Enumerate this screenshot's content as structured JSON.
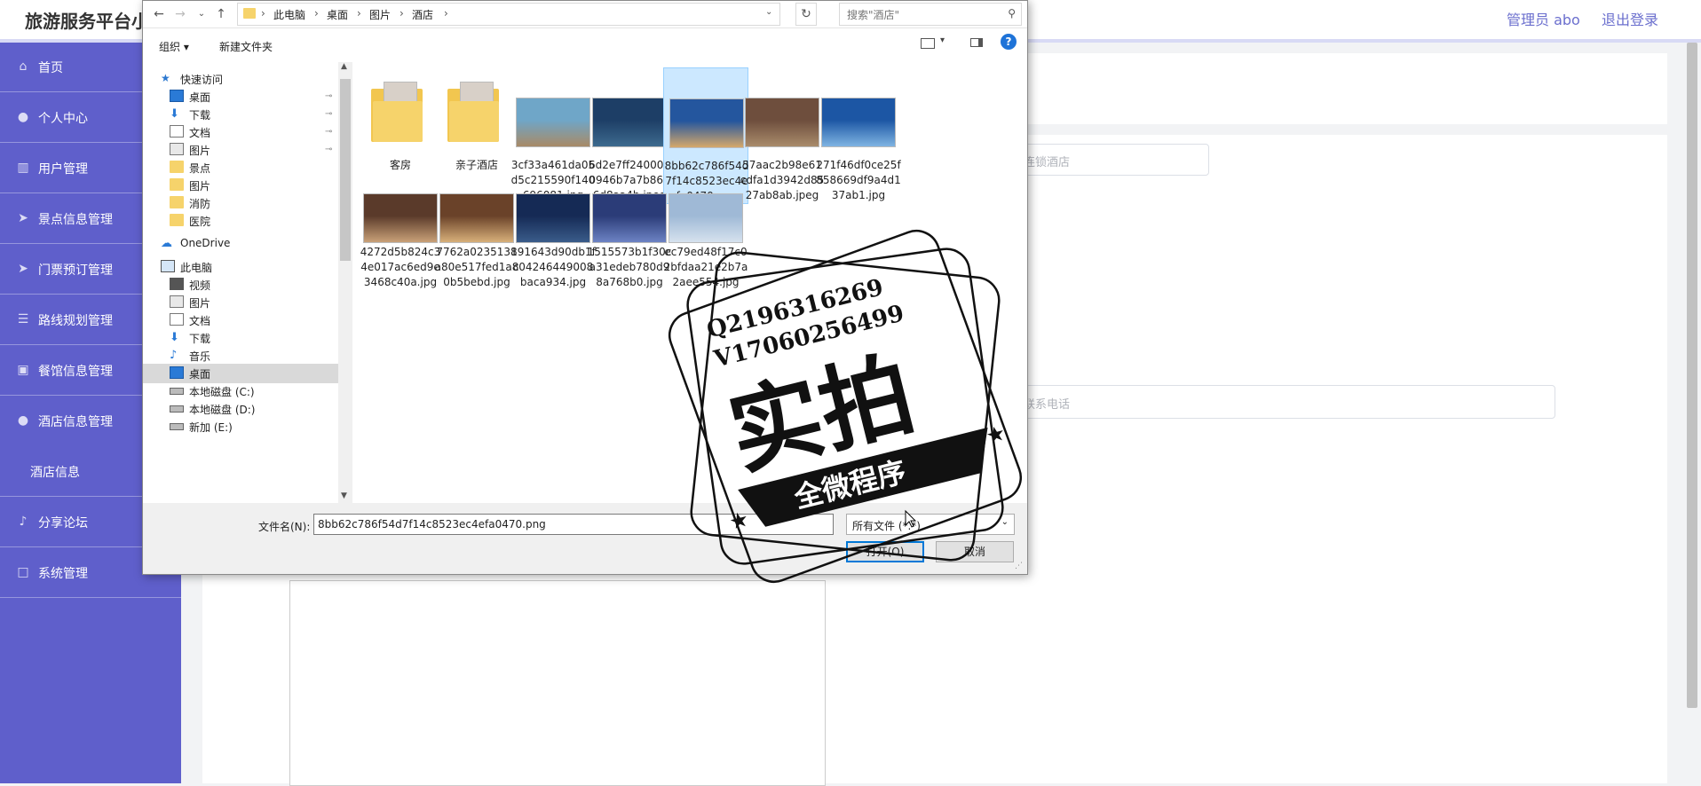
{
  "app": {
    "title": "旅游服务平台小",
    "admin": "管理员 abo",
    "logout": "退出登录"
  },
  "sidebar": {
    "items": [
      {
        "label": "首页",
        "icon": "home-icon"
      },
      {
        "label": "个人中心",
        "icon": "user-icon"
      },
      {
        "label": "用户管理",
        "icon": "grid-icon"
      },
      {
        "label": "景点信息管理",
        "icon": "send-icon"
      },
      {
        "label": "门票预订管理",
        "icon": "send-icon"
      },
      {
        "label": "路线规划管理",
        "icon": "list-icon"
      },
      {
        "label": "餐馆信息管理",
        "icon": "briefcase-icon"
      },
      {
        "label": "酒店信息管理",
        "icon": "user-icon"
      },
      {
        "label": "酒店信息",
        "icon": ""
      },
      {
        "label": "分享论坛",
        "icon": "mic-icon"
      },
      {
        "label": "系统管理",
        "icon": "square-icon"
      }
    ]
  },
  "content": {
    "hotel_field_placeholder": "连锁酒店",
    "phone_field_placeholder": "联系电话"
  },
  "dialog": {
    "breadcrumb": [
      "此电脑",
      "桌面",
      "图片",
      "酒店"
    ],
    "search_placeholder": "搜索\"酒店\"",
    "toolbar": {
      "organize": "组织 ▾",
      "new_folder": "新建文件夹"
    },
    "nav": [
      {
        "label": "快速访问",
        "icon": "star-icon",
        "indent": 0,
        "pinned": false
      },
      {
        "label": "桌面",
        "icon": "desktop-icon",
        "indent": 1,
        "pinned": true
      },
      {
        "label": "下载",
        "icon": "download-icon",
        "indent": 1,
        "pinned": true
      },
      {
        "label": "文档",
        "icon": "document-icon",
        "indent": 1,
        "pinned": true
      },
      {
        "label": "图片",
        "icon": "pictures-icon",
        "indent": 1,
        "pinned": true
      },
      {
        "label": "景点",
        "icon": "folder-icon",
        "indent": 1,
        "pinned": false
      },
      {
        "label": "图片",
        "icon": "folder-icon",
        "indent": 1,
        "pinned": false
      },
      {
        "label": "消防",
        "icon": "folder-icon",
        "indent": 1,
        "pinned": false
      },
      {
        "label": "医院",
        "icon": "folder-icon",
        "indent": 1,
        "pinned": false
      },
      {
        "label": "OneDrive",
        "icon": "cloud-icon",
        "indent": 0,
        "pinned": false
      },
      {
        "label": "此电脑",
        "icon": "computer-icon",
        "indent": 0,
        "pinned": false
      },
      {
        "label": "视频",
        "icon": "video-icon",
        "indent": 1,
        "pinned": false
      },
      {
        "label": "图片",
        "icon": "pictures-icon",
        "indent": 1,
        "pinned": false
      },
      {
        "label": "文档",
        "icon": "document-icon",
        "indent": 1,
        "pinned": false
      },
      {
        "label": "下载",
        "icon": "download-icon",
        "indent": 1,
        "pinned": false
      },
      {
        "label": "音乐",
        "icon": "music-icon",
        "indent": 1,
        "pinned": false
      },
      {
        "label": "桌面",
        "icon": "desktop-icon",
        "indent": 1,
        "pinned": false,
        "selected": true
      },
      {
        "label": "本地磁盘 (C:)",
        "icon": "drive-icon",
        "indent": 1,
        "pinned": false
      },
      {
        "label": "本地磁盘 (D:)",
        "icon": "drive-icon",
        "indent": 1,
        "pinned": false
      },
      {
        "label": "新加 (E:)",
        "icon": "drive-icon",
        "indent": 1,
        "pinned": false
      }
    ],
    "files": [
      {
        "name": "客房",
        "type": "folder"
      },
      {
        "name": "亲子酒店",
        "type": "folder"
      },
      {
        "name": "3cf33a461da05d5c215590f140696081.jpg",
        "type": "image",
        "colors": [
          "#6fa6c8",
          "#a88a66"
        ]
      },
      {
        "name": "6d2e7ff2400070946b7a7b8626d8aa4b.jpeg",
        "type": "image",
        "colors": [
          "#1d3e66",
          "#3d6a8e"
        ]
      },
      {
        "name": "8bb62c786f54d7f14c8523ec4efa0470.png",
        "type": "image",
        "selected": true,
        "colors": [
          "#24569e",
          "#d5a86a"
        ]
      },
      {
        "name": "57aac2b98e61cdfa1d3942d8527ab8ab.jpeg",
        "type": "image",
        "colors": [
          "#6e4e3d",
          "#a98b6b"
        ]
      },
      {
        "name": "271f46df0ce25f858669df9a4d137ab1.jpg",
        "type": "image",
        "colors": [
          "#1c56a4",
          "#7fb4e2"
        ]
      },
      {
        "name": "4272d5b824c34e017ac6ed9e3468c40a.jpg",
        "type": "image",
        "colors": [
          "#5a3a2a",
          "#c9a178"
        ]
      },
      {
        "name": "7762a0235138a80e517fed1a80b5bebd.jpg",
        "type": "image",
        "colors": [
          "#6a4229",
          "#d8b07a"
        ]
      },
      {
        "name": "191643d90db1fc04246449008baca934.jpg",
        "type": "image",
        "colors": [
          "#152a55",
          "#3a5c8a"
        ]
      },
      {
        "name": "1515573b1f30ca31edeb780d98a768b0.jpg",
        "type": "image",
        "colors": [
          "#2b3c78",
          "#6d83c4"
        ]
      },
      {
        "name": "ec79ed48f17c02bfdaa21e2b7a2aee554.jpg",
        "type": "image",
        "colors": [
          "#9fb9d6",
          "#d6e2ee"
        ]
      }
    ],
    "filename_label": "文件名(N):",
    "filename_value": "8bb62c786f54d7f14c8523ec4efa0470.png",
    "filetype": "所有文件 (*.*)",
    "open_label": "打开(O)",
    "cancel_label": "取消"
  },
  "watermark": {
    "line1": "Q2196316269",
    "line2": "V17060256499",
    "big": "实拍",
    "ribbon": "全微程序"
  }
}
